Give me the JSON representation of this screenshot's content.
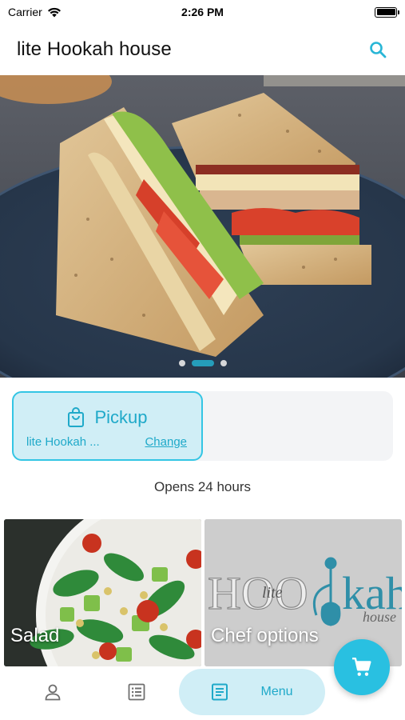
{
  "status_bar": {
    "carrier": "Carrier",
    "time": "2:26 PM"
  },
  "header": {
    "title": "lite Hookah house",
    "search_icon": "search-icon"
  },
  "hero": {
    "image": "club sandwich on dark plate",
    "slide_count": 3,
    "active_slide": 2
  },
  "order_mode": {
    "mode_label": "Pickup",
    "location": "lite Hookah ...",
    "change_label": "Change",
    "icon": "shopping-bag-icon"
  },
  "hours_text": "Opens 24 hours",
  "categories": [
    {
      "label": "Salad"
    },
    {
      "label": "Chef options"
    }
  ],
  "chef_logo": {
    "hoo": "HOO",
    "lite": "lite",
    "kah": "kah",
    "house": "house"
  },
  "bottom_nav": {
    "menu_label": "Menu",
    "icons": [
      "person-icon",
      "list-icon",
      "menu-icon"
    ]
  },
  "cart": {
    "icon": "cart-icon"
  },
  "colors": {
    "accent": "#29c0e1",
    "accent_text": "#1fa9c9",
    "accent_bg": "#d0eef6"
  }
}
